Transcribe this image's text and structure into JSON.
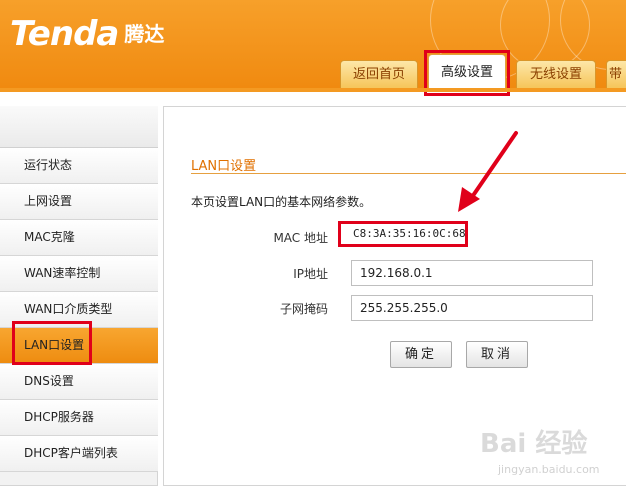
{
  "brand": {
    "logo_text": "Tenda",
    "logo_cn": "腾达"
  },
  "tabs": [
    {
      "label": "返回首页",
      "active": false
    },
    {
      "label": "高级设置",
      "active": true
    },
    {
      "label": "无线设置",
      "active": false
    },
    {
      "label": "带",
      "active": false
    }
  ],
  "sidebar": {
    "items": [
      {
        "label": "运行状态"
      },
      {
        "label": "上网设置"
      },
      {
        "label": "MAC克隆"
      },
      {
        "label": "WAN速率控制"
      },
      {
        "label": "WAN口介质类型"
      },
      {
        "label": "LAN口设置",
        "active": true
      },
      {
        "label": "DNS设置"
      },
      {
        "label": "DHCP服务器"
      },
      {
        "label": "DHCP客户端列表"
      }
    ]
  },
  "main": {
    "section_title": "LAN口设置",
    "description": "本页设置LAN口的基本网络参数。",
    "mac_label": "MAC 地址",
    "mac_value": "C8:3A:35:16:0C:68",
    "ip_label": "IP地址",
    "ip_value": "192.168.0.1",
    "mask_label": "子网掩码",
    "mask_value": "255.255.255.0",
    "confirm_label": "确定",
    "cancel_label": "取消"
  },
  "watermark": {
    "text": "Bai 经验",
    "url": "jingyan.baidu.com"
  },
  "colors": {
    "brand_orange": "#f08a10",
    "highlight_red": "#e0001a"
  },
  "icons": {
    "annotation_arrow": "red-arrow-icon"
  }
}
